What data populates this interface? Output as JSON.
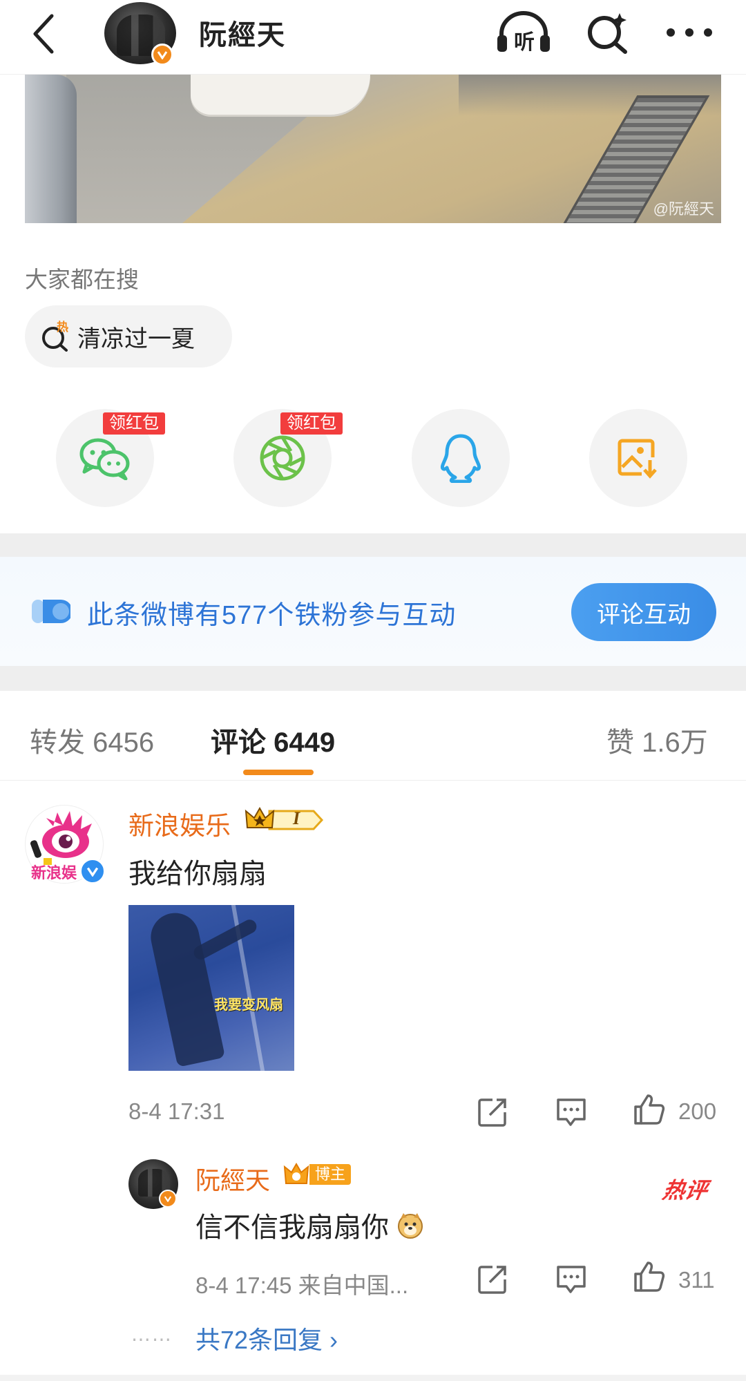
{
  "header": {
    "title": "阮經天",
    "listen_label": "听",
    "icons": [
      "back-icon",
      "listen-icon",
      "search-icon",
      "more-icon"
    ]
  },
  "post": {
    "image_watermark": "@阮經天"
  },
  "search": {
    "heading": "大家都在搜",
    "chip_label": "清凉过一夏",
    "chip_icon_glyph": "热"
  },
  "share": {
    "redpacket_label": "领红包",
    "targets": [
      "wechat",
      "moments",
      "qq",
      "save-image"
    ]
  },
  "fans_banner": {
    "text": "此条微博有577个铁粉参与互动",
    "button_label": "评论互动"
  },
  "tabs": {
    "repost": "转发 6456",
    "comments": "评论 6449",
    "likes": "赞 1.6万"
  },
  "comment": {
    "author": "新浪娱乐",
    "badge_text": "I",
    "avatar_text": "新浪娱",
    "text": "我给你扇扇",
    "image_caption": "我要变风扇",
    "time": "8-4 17:31",
    "likes": "200"
  },
  "reply": {
    "author": "阮經天",
    "badge_label": "博主",
    "text": "信不信我扇扇你",
    "hot_label": "热评",
    "time": "8-4 17:45 来自中国...",
    "likes": "311",
    "dots": "⋯⋯",
    "more_label": "共72条回复 ›"
  },
  "colors": {
    "orange": "#f28a1b",
    "blue_link": "#3a78c4",
    "banner_text": "#2d74d6",
    "wechat_green": "#4cc36a",
    "qq_blue": "#2aa5e8",
    "save_orange": "#f5a623",
    "red": "#f23d3d"
  }
}
